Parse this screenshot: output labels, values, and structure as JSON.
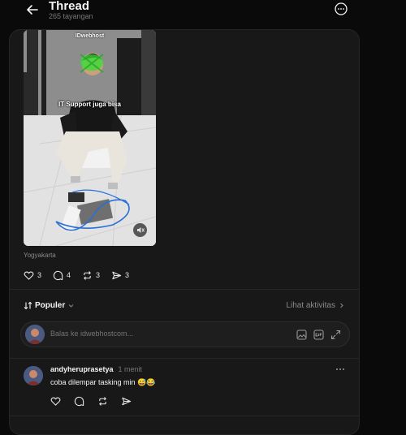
{
  "header": {
    "title": "Thread",
    "views": "265 tayangan"
  },
  "post": {
    "watermark": "IDwebhost",
    "overlay_caption": "IT Support juga bisa",
    "location": "Yogyakarta",
    "counts": {
      "likes": "3",
      "comments": "4",
      "reposts": "3",
      "shares": "3"
    }
  },
  "sort": {
    "label": "Populer",
    "activity_link": "Lihat aktivitas"
  },
  "reply": {
    "placeholder": "Balas ke idwebhostcom..."
  },
  "comments": [
    {
      "username": "andyheruprasetya",
      "time": "1 menit",
      "text": "coba dilempar tasking min 😅😂"
    }
  ],
  "colors": {
    "background": "#0a0a0a",
    "panel": "#181818",
    "border": "#262626",
    "text": "#f3f5f7",
    "muted": "#777777"
  },
  "icons": [
    "back-arrow-icon",
    "more-circle-icon",
    "heart-icon",
    "comment-icon",
    "repost-icon",
    "share-icon",
    "sort-icon",
    "chevron-down-icon",
    "chevron-right-icon",
    "image-icon",
    "gif-icon",
    "expand-icon",
    "mute-icon",
    "more-dots-icon"
  ]
}
